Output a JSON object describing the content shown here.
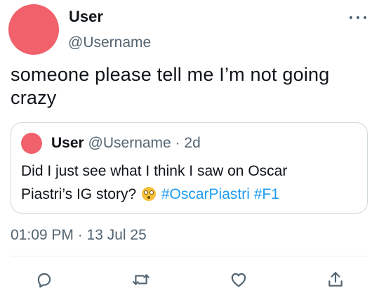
{
  "tweet": {
    "author": {
      "display_name": "User",
      "handle": "@Username",
      "avatar_color": "#f0616b"
    },
    "text": "someone please tell me I’m not going crazy",
    "timestamp": "01:09 PM · 13 Jul 25",
    "more_icon": "more-horizontal-icon"
  },
  "quoted_tweet": {
    "author": {
      "display_name": "User",
      "handle": "@Username",
      "avatar_color": "#f0616b"
    },
    "separator": "·",
    "time": "2d",
    "text_line1": "Did I just see what I think I saw on Oscar",
    "text_line2": "Piastri’s IG story?",
    "emoji": "flushed-face-emoji",
    "hashtags": [
      "#OscarPiastri",
      "#F1"
    ]
  },
  "actions": [
    {
      "name": "reply",
      "icon": "reply-icon"
    },
    {
      "name": "retweet",
      "icon": "retweet-icon"
    },
    {
      "name": "like",
      "icon": "heart-icon"
    },
    {
      "name": "share",
      "icon": "share-icon"
    }
  ],
  "colors": {
    "accent": "#1d9bf0",
    "text_primary": "#0f1419",
    "text_secondary": "#536471",
    "border": "#cfd9de",
    "avatar": "#f0616b"
  }
}
